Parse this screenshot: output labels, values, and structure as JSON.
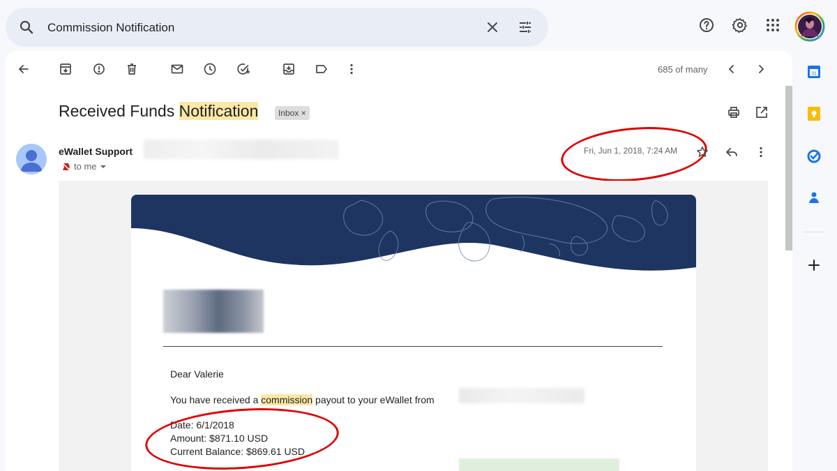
{
  "search": {
    "query": "Commission Notification"
  },
  "toolbar": {
    "pager": "685 of many"
  },
  "message": {
    "subject_plain": "Received Funds",
    "subject_highlight": "Notification",
    "label": "Inbox",
    "label_remove": "×",
    "sender": "eWallet Support",
    "recipient": "to me",
    "date": "Fri, Jun 1, 2018, 7:24 AM"
  },
  "email_body": {
    "greeting": "Dear Valerie",
    "line_before": "You have received a",
    "highlight": "commission",
    "line_after": "payout to your eWallet from",
    "date_line": "Date: 6/1/2018",
    "amount_line": "Amount: $871.10 USD",
    "balance_line": "Current Balance: $869.61 USD"
  },
  "colors": {
    "banner": "#1e3461",
    "highlight": "#fbe8a6",
    "annotation": "#e00000",
    "calendar": "#1a73e8",
    "keep": "#fbbc04",
    "tasks": "#1a73e8",
    "contacts": "#1a73e8"
  },
  "icons": [
    "search-icon",
    "clear-icon",
    "tune-icon",
    "help-icon",
    "settings-icon",
    "apps-icon",
    "back-icon",
    "archive-icon",
    "report-spam-icon",
    "delete-icon",
    "mark-unread-icon",
    "snooze-icon",
    "add-task-icon",
    "move-to-icon",
    "label-icon",
    "more-icon",
    "prev-icon",
    "next-icon",
    "print-icon",
    "open-new-window-icon",
    "star-icon",
    "reply-icon",
    "calendar-icon",
    "keep-icon",
    "tasks-icon",
    "contacts-icon",
    "add-icon"
  ]
}
